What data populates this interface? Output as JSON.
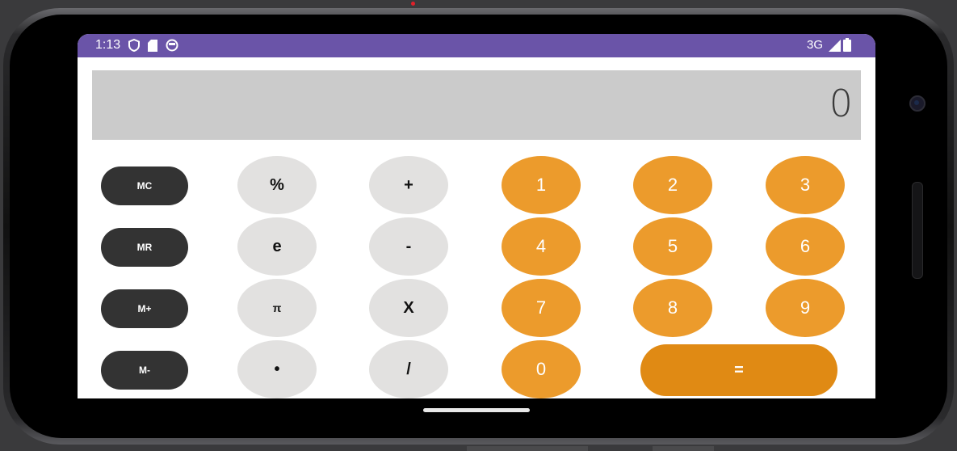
{
  "status_bar": {
    "time": "1:13",
    "network": "3G",
    "left_icons": [
      "shield-icon",
      "sd-card-icon",
      "face-icon"
    ],
    "right_icons": [
      "signal-icon",
      "battery-icon"
    ],
    "bar_color": "#6a54a8"
  },
  "display": {
    "value": "0"
  },
  "memory_buttons": [
    "MC",
    "MR",
    "M+",
    "M-"
  ],
  "operator_column_1": [
    "%",
    "e",
    "π",
    "•"
  ],
  "operator_column_2": [
    "+",
    "-",
    "X",
    "/"
  ],
  "number_buttons": {
    "row1": [
      "1",
      "2",
      "3"
    ],
    "row2": [
      "4",
      "5",
      "6"
    ],
    "row3": [
      "7",
      "8",
      "9"
    ],
    "zero": "0"
  },
  "equals_label": "=",
  "colors": {
    "memory": "#333333",
    "operator": "#e2e1e0",
    "number": "#ec9b2c",
    "equals": "#e08a14",
    "display": "#cbcbcb"
  }
}
